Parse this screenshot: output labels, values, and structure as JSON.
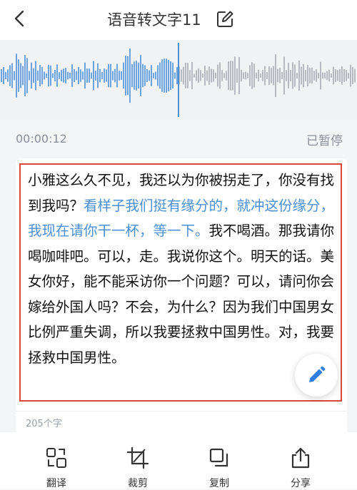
{
  "header": {
    "title": "语音转文字11",
    "back_icon": "chevron-left-icon",
    "edit_icon": "edit-icon"
  },
  "player": {
    "time": "00:00:12",
    "status": "已暂停",
    "played_color": "#4a8fd8",
    "unplayed_color": "#a7abb2",
    "progress_fraction": 0.5
  },
  "transcript": {
    "part1": "小雅这么久不见，我还以为你被拐走了，你没有找到我吗？",
    "highlight": "看样子我们挺有缘分的，就冲这份缘分，我现在请你干一杯，等一下。",
    "part2": "我不喝酒。那我请你喝咖啡吧。可以，走。我说你这个。明天的话。美女你好，能不能采访你一个问题？可以，请问你会嫁给外国人吗？不会，为什么？因为我们中国男女比例严重失调，所以我要拯救中国男性。对，我要拯救中国男性。",
    "highlight_color": "#4a8fd8",
    "char_count": "205个字"
  },
  "toolbar": {
    "items": [
      {
        "label": "翻译",
        "icon": "translate-icon"
      },
      {
        "label": "裁剪",
        "icon": "crop-icon"
      },
      {
        "label": "复制",
        "icon": "copy-icon"
      },
      {
        "label": "分享",
        "icon": "share-icon"
      }
    ]
  },
  "fab": {
    "icon": "pencil-icon",
    "color": "#2f7fe0"
  }
}
